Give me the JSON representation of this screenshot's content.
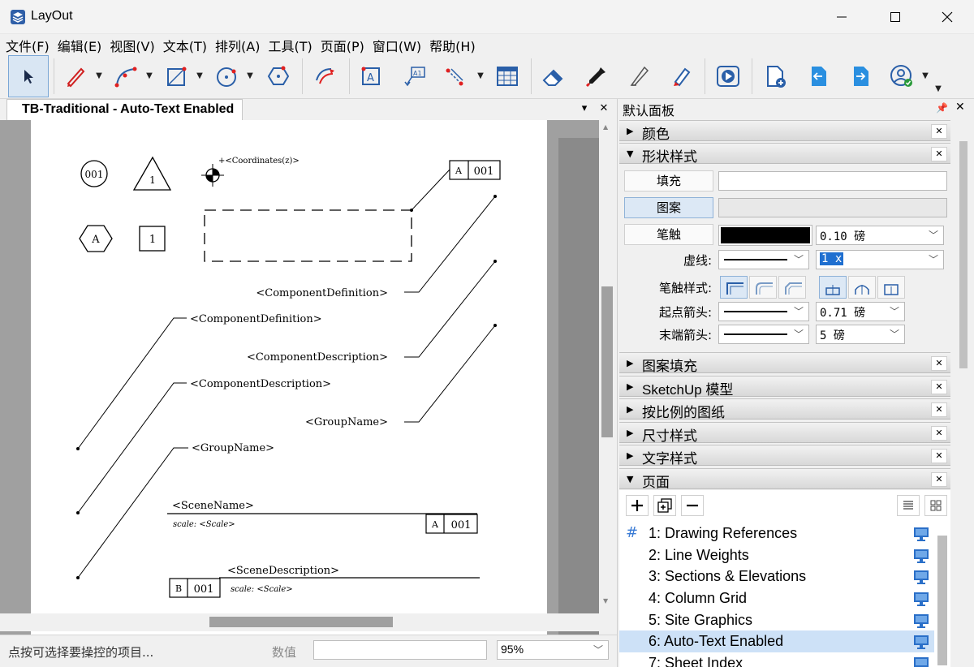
{
  "window": {
    "title": "LayOut"
  },
  "menu": [
    "文件(F)",
    "编辑(E)",
    "视图(V)",
    "文本(T)",
    "排列(A)",
    "工具(T)",
    "页面(P)",
    "窗口(W)",
    "帮助(H)"
  ],
  "document": {
    "tab_title": "TB-Traditional - Auto-Text Enabled"
  },
  "drawing": {
    "circle_tag": "001",
    "triangle_tag": "1",
    "hexagon_tag": "A",
    "square_tag": "1",
    "coord_label": "+<Coordinates(z)>",
    "callout_left": "A",
    "callout_right": "001",
    "labels": {
      "comp_def_right": "<ComponentDefinition>",
      "comp_def_left": "<ComponentDefinition>",
      "comp_desc_right": "<ComponentDescription>",
      "comp_desc_left": "<ComponentDescription>",
      "group_right": "<GroupName>",
      "group_left": "<GroupName>",
      "scene_name": "<SceneName>",
      "scale1": "scale: <Scale>",
      "scene_tag_left": "A",
      "scene_tag_right": "001",
      "scene_desc": "<SceneDescription>",
      "scene2_left": "B",
      "scene2_right": "001",
      "scale2": "scale: <Scale>"
    }
  },
  "status": {
    "hint": "点按可选择要操控的项目...",
    "value_label": "数值",
    "zoom": "95%"
  },
  "panel": {
    "title": "默认面板",
    "sections": {
      "color": "颜色",
      "shape_style": "形状样式",
      "pattern_fill": "图案填充",
      "sketchup_model": "SketchUp 模型",
      "scaled_drawing": "按比例的图纸",
      "dimension_style": "尺寸样式",
      "text_style": "文字样式",
      "pages": "页面"
    },
    "shape": {
      "fill": "填充",
      "pattern": "图案",
      "stroke": "笔触",
      "stroke_width": "0.10 磅",
      "dash_label": "虚线:",
      "dash_scale": "1 x",
      "cap_label": "笔触样式:",
      "start_arrow_label": "起点箭头:",
      "start_arrow_size": "0.71 磅",
      "end_arrow_label": "末端箭头:",
      "end_arrow_size": "5 磅"
    },
    "pages": [
      "1: Drawing References",
      "2: Line Weights",
      "3: Sections & Elevations",
      "4: Column Grid",
      "5: Site Graphics",
      "6: Auto-Text Enabled",
      "7: Sheet Index"
    ],
    "current_page_marker": "#"
  },
  "colors": {
    "accent": "#1f6fd0",
    "selected_row": "#cde1f7",
    "tool_red": "#e02020"
  }
}
